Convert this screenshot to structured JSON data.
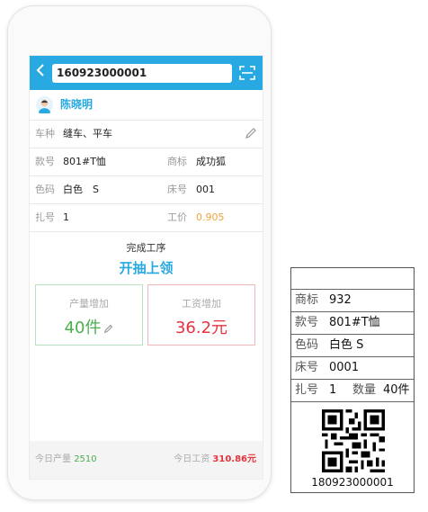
{
  "search": {
    "value": "160923000001"
  },
  "user": {
    "name": "陈晓明"
  },
  "info": {
    "vehicle_label": "车种",
    "vehicle_value": "缝车、平车",
    "style_label": "款号",
    "style_value": "801#T恤",
    "brand_label": "商标",
    "brand_value": "成功狐",
    "color_label": "色码",
    "color_value": "白色　S",
    "bed_label": "床号",
    "bed_value": "001",
    "bundle_label": "扎号",
    "bundle_value": "1",
    "price_label": "工价",
    "price_value": "0.905"
  },
  "process": {
    "title": "完成工序",
    "name": "开抽上领"
  },
  "output_box": {
    "title": "产量增加",
    "value": "40件"
  },
  "wage_box": {
    "title": "工资增加",
    "value": "36.2元"
  },
  "footer": {
    "output_label": "今日产量",
    "output_value": "2510",
    "wage_label": "今日工资",
    "wage_value": "310.86元"
  },
  "label_card": {
    "brand_label": "商标",
    "brand_value": "932",
    "style_label": "款号",
    "style_value": "801#T恤",
    "color_label": "色码",
    "color_value": "白色 S",
    "bed_label": "床号",
    "bed_value": "0001",
    "bundle_label": "扎号",
    "bundle_value": "1",
    "qty_label": "数量",
    "qty_value": "40件",
    "qr_text": "180923000001"
  },
  "colors": {
    "accent": "#29a9e1",
    "green": "#4aaf4f",
    "red": "#e8323c",
    "orange": "#f0a23c"
  }
}
